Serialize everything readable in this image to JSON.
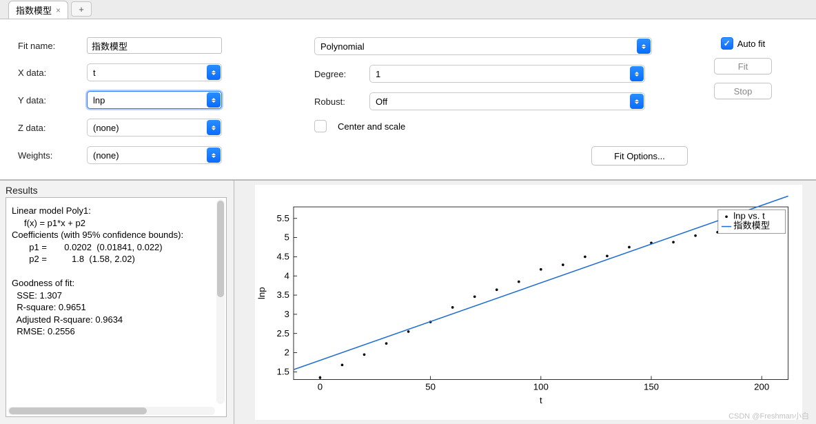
{
  "tabs": {
    "items": [
      {
        "label": "指数模型"
      }
    ]
  },
  "left": {
    "fit_name_label": "Fit name:",
    "fit_name_value": "指数模型",
    "x_label": "X data:",
    "x_value": "t",
    "y_label": "Y data:",
    "y_value": "lnp",
    "z_label": "Z data:",
    "z_value": "(none)",
    "w_label": "Weights:",
    "w_value": "(none)"
  },
  "mid": {
    "model_value": "Polynomial",
    "degree_label": "Degree:",
    "degree_value": "1",
    "robust_label": "Robust:",
    "robust_value": "Off",
    "center_label": "Center and scale",
    "fit_options_label": "Fit Options..."
  },
  "right": {
    "autofit_label": "Auto fit",
    "fit_label": "Fit",
    "stop_label": "Stop"
  },
  "results": {
    "title": "Results",
    "text": "Linear model Poly1:\n     f(x) = p1*x + p2\nCoefficients (with 95% confidence bounds):\n       p1 =       0.0202  (0.01841, 0.022)\n       p2 =          1.8  (1.58, 2.02)\n\nGoodness of fit:\n  SSE: 1.307\n  R-square: 0.9651\n  Adjusted R-square: 0.9634\n  RMSE: 0.2556"
  },
  "chart_data": {
    "type": "scatter+line",
    "title": "",
    "xlabel": "t",
    "ylabel": "lnp",
    "xlim": [
      -12,
      212
    ],
    "ylim": [
      1.3,
      5.8
    ],
    "x_ticks": [
      0,
      50,
      100,
      150,
      200
    ],
    "y_ticks": [
      1.5,
      2,
      2.5,
      3,
      3.5,
      4,
      4.5,
      5,
      5.5
    ],
    "legend": {
      "position": "top-right",
      "entries": [
        "lnp vs. t",
        "指数模型"
      ]
    },
    "series": [
      {
        "name": "lnp vs. t",
        "kind": "scatter",
        "x": [
          0,
          10,
          20,
          30,
          40,
          50,
          60,
          70,
          80,
          90,
          100,
          110,
          120,
          130,
          140,
          150,
          160,
          170,
          180,
          190,
          200
        ],
        "y": [
          1.35,
          1.68,
          1.95,
          2.24,
          2.55,
          2.8,
          3.18,
          3.46,
          3.64,
          3.85,
          4.17,
          4.29,
          4.5,
          4.52,
          4.75,
          4.86,
          4.88,
          5.05,
          5.14,
          5.22,
          5.33
        ]
      },
      {
        "name": "指数模型",
        "kind": "line",
        "color": "#1f6dd0",
        "x": [
          -12,
          212
        ],
        "y": [
          1.558,
          6.082
        ]
      }
    ]
  },
  "watermark": "CSDN @Freshman小白"
}
